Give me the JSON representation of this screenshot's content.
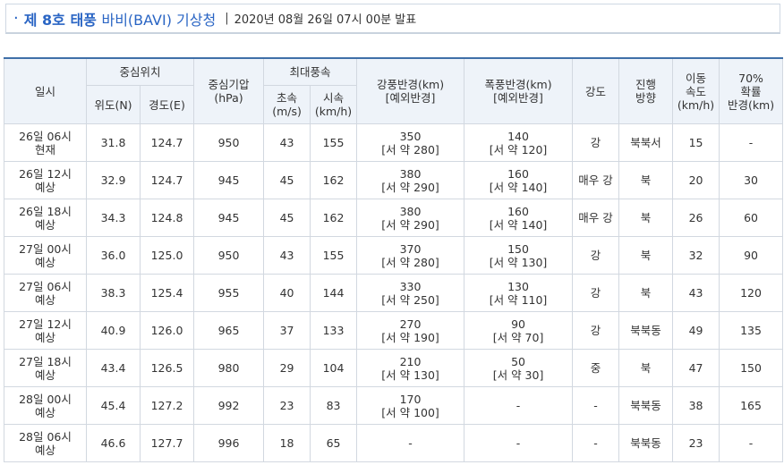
{
  "header": {
    "bullet": "·",
    "title_prefix": "제 8호 태풍 ",
    "title_name": "바비(BAVI) 기상청",
    "separator": "|",
    "announce": "2020년 08월 26일 07시 00분 발표"
  },
  "columns": {
    "datetime": "일시",
    "center": "중심위치",
    "lat": "위도(N)",
    "lon": "경도(E)",
    "pressure_l1": "중심기압",
    "pressure_l2": "(hPa)",
    "maxwind": "최대풍속",
    "ms_l1": "초속",
    "ms_l2": "(m/s)",
    "kmh_l1": "시속",
    "kmh_l2": "(km/h)",
    "strong_l1": "강풍반경(km)",
    "strong_l2": "[예외반경]",
    "storm_l1": "폭풍반경(km)",
    "storm_l2": "[예외반경]",
    "intensity": "강도",
    "dir_l1": "진행",
    "dir_l2": "방향",
    "speed_l1": "이동",
    "speed_l2": "속도",
    "speed_l3": "(km/h)",
    "p70_l1": "70%",
    "p70_l2": "확률",
    "p70_l3": "반경(km)"
  },
  "rows": [
    {
      "time": "26일 06시",
      "note": "현재",
      "lat": "31.8",
      "lon": "124.7",
      "pres": "950",
      "ms": "43",
      "kmh": "155",
      "strong": "350",
      "strong_ex": "[서 약 280]",
      "storm": "140",
      "storm_ex": "[서 약 120]",
      "intensity": "강",
      "dir": "북북서",
      "speed": "15",
      "p70": "-"
    },
    {
      "time": "26일 12시",
      "note": "예상",
      "lat": "32.9",
      "lon": "124.7",
      "pres": "945",
      "ms": "45",
      "kmh": "162",
      "strong": "380",
      "strong_ex": "[서 약 290]",
      "storm": "160",
      "storm_ex": "[서 약 140]",
      "intensity": "매우 강",
      "dir": "북",
      "speed": "20",
      "p70": "30"
    },
    {
      "time": "26일 18시",
      "note": "예상",
      "lat": "34.3",
      "lon": "124.8",
      "pres": "945",
      "ms": "45",
      "kmh": "162",
      "strong": "380",
      "strong_ex": "[서 약 290]",
      "storm": "160",
      "storm_ex": "[서 약 140]",
      "intensity": "매우 강",
      "dir": "북",
      "speed": "26",
      "p70": "60"
    },
    {
      "time": "27일 00시",
      "note": "예상",
      "lat": "36.0",
      "lon": "125.0",
      "pres": "950",
      "ms": "43",
      "kmh": "155",
      "strong": "370",
      "strong_ex": "[서 약 280]",
      "storm": "150",
      "storm_ex": "[서 약 130]",
      "intensity": "강",
      "dir": "북",
      "speed": "32",
      "p70": "90"
    },
    {
      "time": "27일 06시",
      "note": "예상",
      "lat": "38.3",
      "lon": "125.4",
      "pres": "955",
      "ms": "40",
      "kmh": "144",
      "strong": "330",
      "strong_ex": "[서 약 250]",
      "storm": "130",
      "storm_ex": "[서 약 110]",
      "intensity": "강",
      "dir": "북",
      "speed": "43",
      "p70": "120"
    },
    {
      "time": "27일 12시",
      "note": "예상",
      "lat": "40.9",
      "lon": "126.0",
      "pres": "965",
      "ms": "37",
      "kmh": "133",
      "strong": "270",
      "strong_ex": "[서 약 190]",
      "storm": "90",
      "storm_ex": "[서 약 70]",
      "intensity": "강",
      "dir": "북북동",
      "speed": "49",
      "p70": "135"
    },
    {
      "time": "27일 18시",
      "note": "예상",
      "lat": "43.4",
      "lon": "126.5",
      "pres": "980",
      "ms": "29",
      "kmh": "104",
      "strong": "210",
      "strong_ex": "[서 약 130]",
      "storm": "50",
      "storm_ex": "[서 약 30]",
      "intensity": "중",
      "dir": "북",
      "speed": "47",
      "p70": "150"
    },
    {
      "time": "28일 00시",
      "note": "예상",
      "lat": "45.4",
      "lon": "127.2",
      "pres": "992",
      "ms": "23",
      "kmh": "83",
      "strong": "170",
      "strong_ex": "[서 약 100]",
      "storm": "-",
      "storm_ex": "",
      "intensity": "-",
      "dir": "북북동",
      "speed": "38",
      "p70": "165"
    },
    {
      "time": "28일 06시",
      "note": "예상",
      "lat": "46.6",
      "lon": "127.7",
      "pres": "996",
      "ms": "18",
      "kmh": "65",
      "strong": "-",
      "strong_ex": "",
      "storm": "-",
      "storm_ex": "",
      "intensity": "-",
      "dir": "북북동",
      "speed": "23",
      "p70": "-"
    }
  ]
}
